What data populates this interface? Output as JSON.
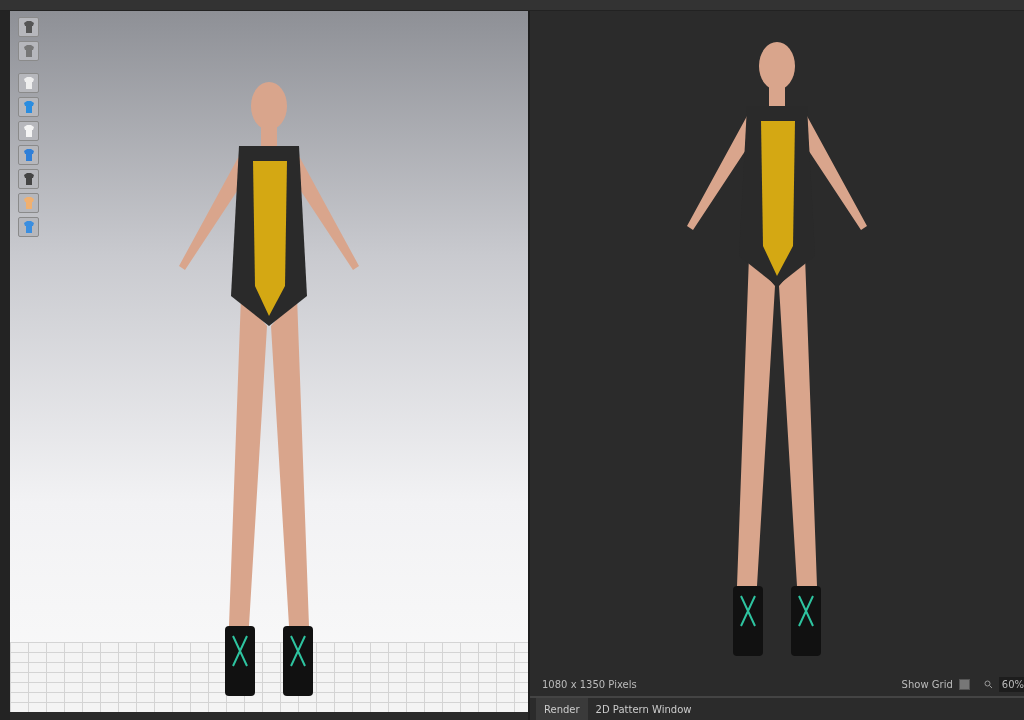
{
  "render_panel": {
    "resolution": "1080 x 1350 Pixels",
    "show_grid": {
      "label": "Show Grid",
      "checked": false
    },
    "zoom": "60%"
  },
  "tabs": [
    {
      "label": "Render",
      "selected": true
    },
    {
      "label": "2D Pattern Window",
      "selected": false
    }
  ]
}
